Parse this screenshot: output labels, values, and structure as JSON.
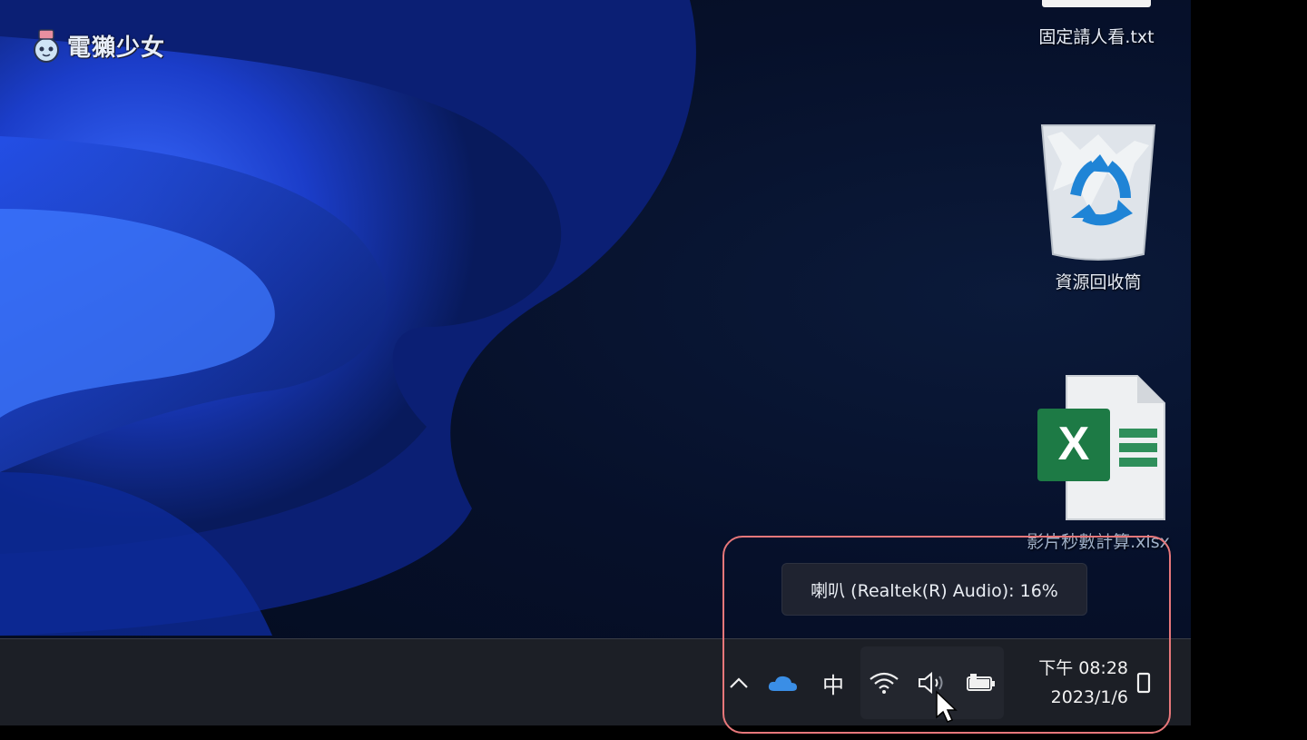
{
  "watermark": {
    "text": "電獺少女"
  },
  "desktop_icons": [
    {
      "label": "固定請人看.txt",
      "icon": "text-file-icon"
    },
    {
      "label": "資源回收筒",
      "icon": "recycle-bin-icon"
    },
    {
      "label": "影片秒數計算.xlsx",
      "icon": "excel-file-icon"
    }
  ],
  "tooltip": {
    "text": "喇叭 (Realtek(R) Audio): 16%"
  },
  "tray": {
    "chevron_icon": "chevron-up-icon",
    "cloud_icon": "onedrive-cloud-icon",
    "ime_label": "中",
    "wifi_icon": "wifi-icon",
    "volume_icon": "speaker-icon",
    "battery_icon": "battery-icon",
    "show_desktop_icon": "show-desktop-icon"
  },
  "clock": {
    "time": "下午 08:28",
    "date": "2023/1/6"
  },
  "colors": {
    "highlight": "#e7777a",
    "taskbar": "#1c1f26",
    "onedrive": "#3a8ee6",
    "excel": "#1d7a45"
  }
}
